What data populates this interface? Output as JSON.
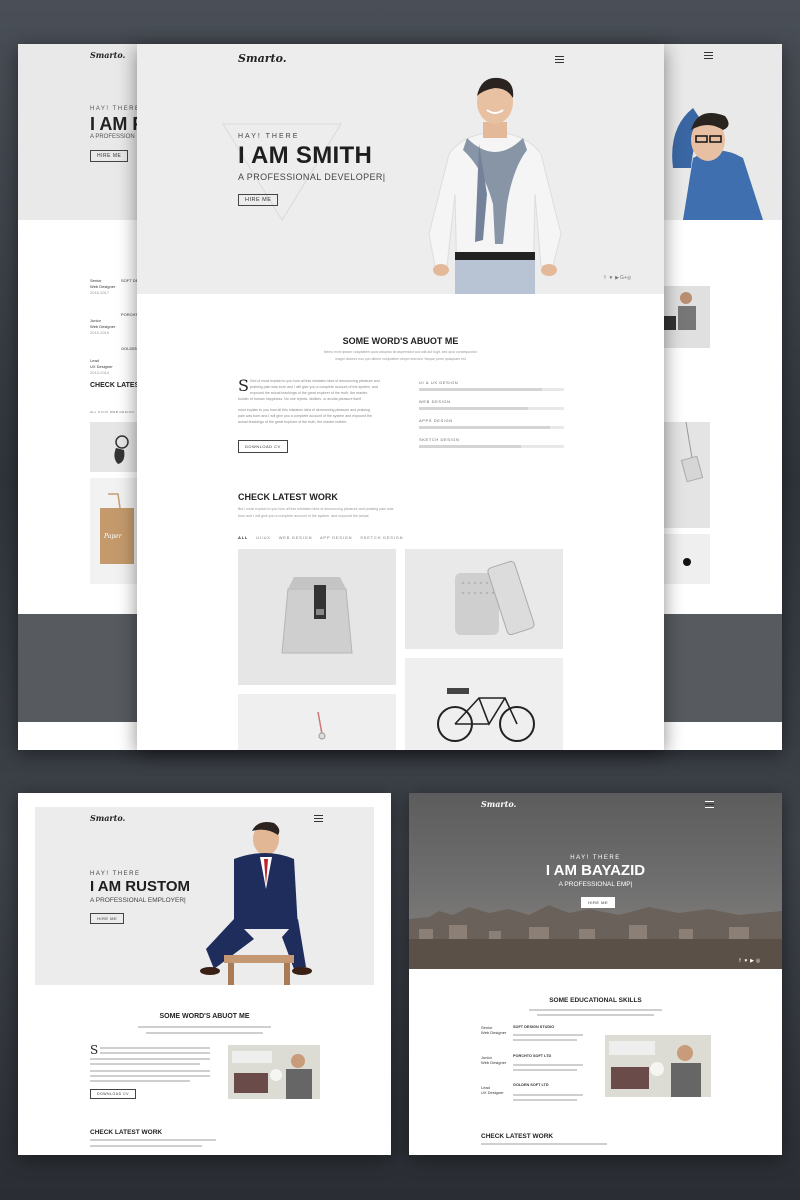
{
  "brand": "Smarto.",
  "main": {
    "greeting": "HAY! THERE",
    "name": "I AM SMITH",
    "role": "A PROFESSIONAL DEVELOPER|",
    "hire": "HIRE ME",
    "social": [
      "f",
      "♥",
      "▶",
      "G+",
      "◎"
    ],
    "about_title": "SOME WORD'S ABUOT ME",
    "about_sub1": "Nemo enim ipsam voluptatem quia voluptas sit aspernatur aut odit aut fugit, sed quia consequuntur",
    "about_sub2": "magni dolores eos qui ratione voluptatem sequi nesciunt. Neque porro quisquam est",
    "about_p1a": "Sed ut must explain to you how all this mistaken idea of denouncing pleasure and",
    "about_p1b": "praising pain was born and I will give you a complete account of the system, and",
    "about_p1c": "expound the actual teachings of the great explorer of the truth, the master-",
    "about_p1d": "builder of human happiness. No one rejects, dislikes, or avoids pleasure itself",
    "about_p2a": "must explain to you how all this mistaken idea of denouncing pleasure and praising",
    "about_p2b": "pain was born and I will give you a complete account of the system and expound the",
    "about_p2c": "actual teachings of the great explorer of the truth, the master-builder.",
    "download": "DOWNLOAD CV",
    "skills": [
      {
        "label": "UI & UX DESIGN",
        "level": 0.85
      },
      {
        "label": "WEB DESIGN",
        "level": 0.75
      },
      {
        "label": "APPS DESIGN",
        "level": 0.9
      },
      {
        "label": "SKETCH DESIGN",
        "level": 0.7
      }
    ],
    "work_title": "CHECK LATEST WORK",
    "work_sub1": "But I must explain to you how all this mistaken idea of denouncing pleasure and praising pain was",
    "work_sub2": "born and I will give you a complete account of the system, and expound the actual",
    "filters": [
      "ALL",
      "UI/UX",
      "WEB DESIGN",
      "APP DESIGN",
      "SKETCH DESIGN"
    ]
  },
  "back_left": {
    "greeting": "HAY! THERE",
    "name": "I AM F",
    "role": "A PROFESSION",
    "hire": "HIRE ME",
    "timeline": [
      {
        "label": "Senior\nWeb Designer",
        "year": "2016-2017",
        "company": "SOFT DES"
      },
      {
        "label": "Junior\nWeb Designer",
        "year": "2015-2016",
        "company": "PORCHTO"
      },
      {
        "label": "Lead\nUX Designer",
        "year": "2013-2014",
        "company": "GOLDEN"
      }
    ],
    "work_title": "CHECK LATEST",
    "filters": "ALL  UI/UX  WEB DESIGN"
  },
  "bottom_left": {
    "greeting": "HAY! THERE",
    "name": "I AM RUSTOM",
    "role": "A PROFESSIONAL EMPLOYER|",
    "hire": "HIRE ME",
    "about_title": "SOME WORD'S ABUOT ME",
    "download": "DOWNLOAD CV",
    "work_title": "CHECK LATEST WORK"
  },
  "bottom_right": {
    "greeting": "HAY! THERE",
    "name": "I AM BAYAZID",
    "role": "A PROFESSIONAL EMP|",
    "hire": "HIRE ME",
    "skills_title": "SOME EDUCATIONAL SKILLS",
    "timeline": [
      {
        "role": "Senior\nWeb Designer",
        "company": "SOFT DESIGN STUDIO"
      },
      {
        "role": "Junior\nWeb Designer",
        "company": "PORCHTO SOFT LTD"
      },
      {
        "role": "Lead\nUX Designer",
        "company": "GOLDEN SOFT LTD"
      }
    ],
    "work_title": "CHECK LATEST WORK"
  },
  "colors": {
    "accent": "#222222",
    "hero_bg": "#ededed",
    "city_sky": "#6f6f6f"
  }
}
